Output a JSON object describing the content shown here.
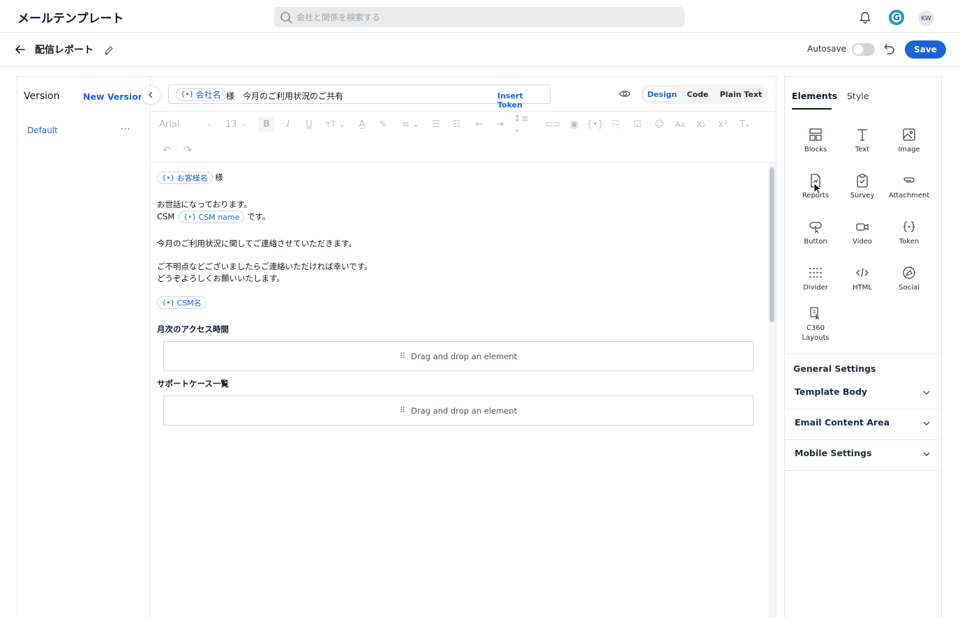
{
  "header": {
    "app_title": "メールテンプレート",
    "search_placeholder": "会社と関係を検索する",
    "avatar_initials": "KW",
    "g_letter": "G"
  },
  "subbar": {
    "template_name": "配信レポート",
    "autosave_label": "Autosave",
    "save_label": "Save"
  },
  "left_panel": {
    "title": "Version",
    "new_version_label": "New Version",
    "versions": [
      {
        "label": "Default",
        "more": "···"
      }
    ]
  },
  "editor": {
    "subject_token": "会社名",
    "subject_text": "様　今月のご利用状況のご共有",
    "insert_token_label": "Insert Token",
    "modes": [
      "Design",
      "Code",
      "Plain Text"
    ],
    "active_mode": "Design",
    "font_name": "Arial",
    "font_size": "13",
    "body": {
      "line1_token": "お客様名",
      "line1_suffix": "様",
      "line2": "お世話になっております。",
      "line3_prefix": "CSM",
      "line3_token": "CSM name",
      "line3_suffix": "です。",
      "line4": "今月のご利用状況に関してご連絡させていただきます。",
      "line5": "ご不明点などございましたらご連絡いただければ幸いです。",
      "line6": "どうぞよろしくお願いいたします。",
      "signature_token": "CSM名",
      "section1_heading": "月次のアクセス時間",
      "section2_heading": "サポートケース一覧",
      "dropzone_label": "Drag and drop an element"
    }
  },
  "right_panel": {
    "tabs": [
      "Elements",
      "Style"
    ],
    "active_tab": "Elements",
    "elements": [
      "Blocks",
      "Text",
      "Image",
      "Reports",
      "Survey",
      "Attachment",
      "Button",
      "Video",
      "Token",
      "Divider",
      "HTML",
      "Social",
      "C360\nLayouts"
    ],
    "general_settings_title": "General Settings",
    "accordions": [
      "Template Body",
      "Email Content Area",
      "Mobile Settings"
    ]
  },
  "colors": {
    "accent": "#1a63d8",
    "toolbar_disabled": "#b9bec6"
  }
}
